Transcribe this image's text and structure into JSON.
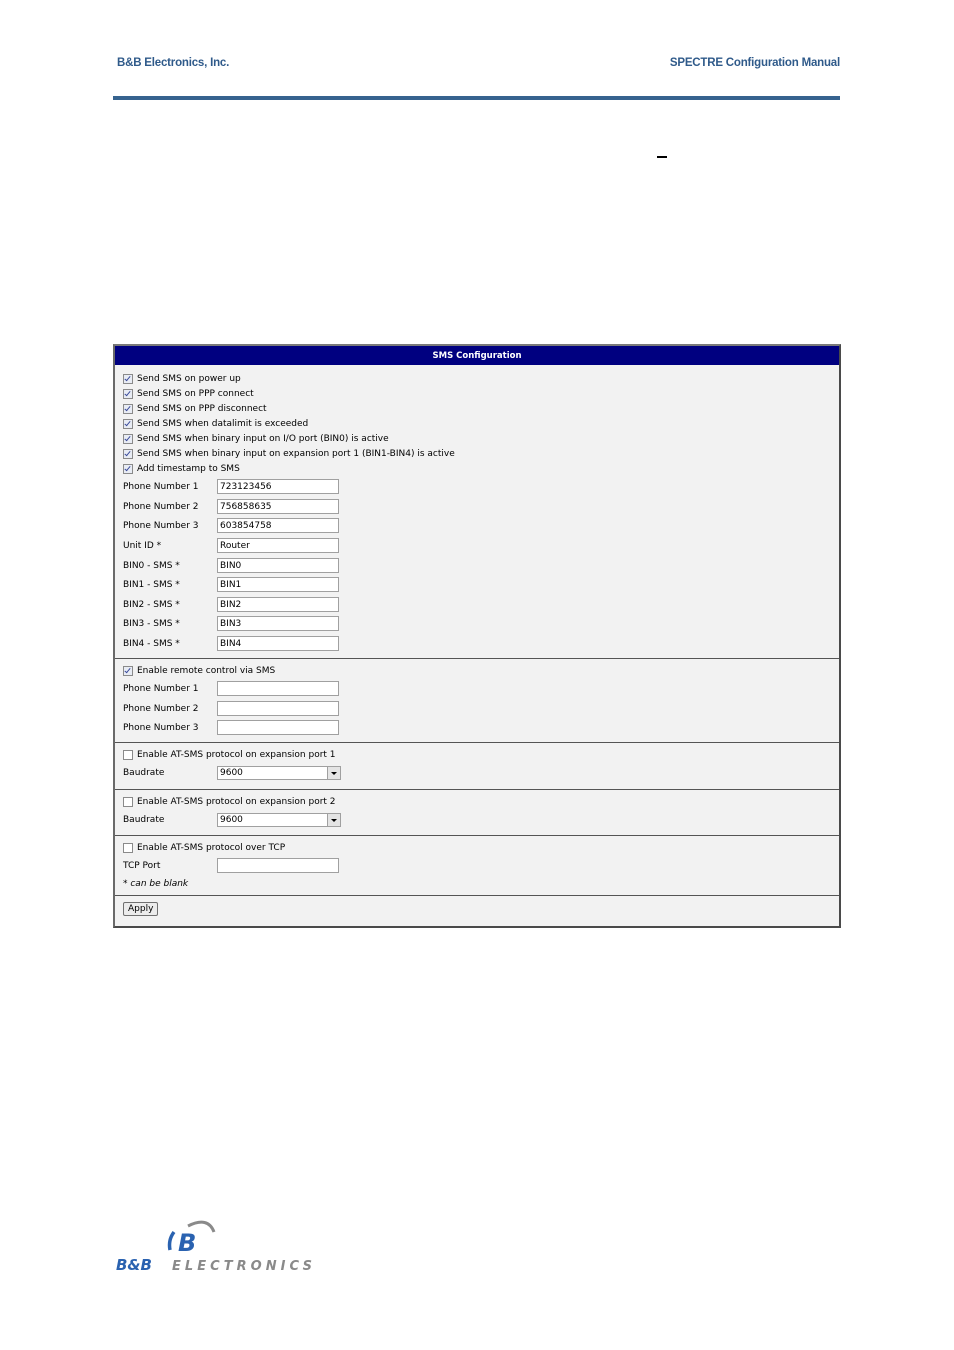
{
  "header": {
    "company": "B&B Electronics, Inc.",
    "manual_title": "SPECTRE Configuration Manual"
  },
  "panel": {
    "title": "SMS Configuration",
    "checkboxes": [
      {
        "label": "Send SMS on power up",
        "checked": true
      },
      {
        "label": "Send SMS on PPP connect",
        "checked": true
      },
      {
        "label": "Send SMS on PPP disconnect",
        "checked": true
      },
      {
        "label": "Send SMS when datalimit is exceeded",
        "checked": true
      },
      {
        "label": "Send SMS when binary input on I/O port (BIN0) is active",
        "checked": true
      },
      {
        "label": "Send SMS when binary input on expansion port 1 (BIN1-BIN4) is active",
        "checked": true
      },
      {
        "label": "Add timestamp to SMS",
        "checked": true
      }
    ],
    "fields": [
      {
        "label": "Phone Number 1",
        "value": "723123456"
      },
      {
        "label": "Phone Number 2",
        "value": "756858635"
      },
      {
        "label": "Phone Number 3",
        "value": "603854758"
      },
      {
        "label": "Unit ID *",
        "value": "Router"
      },
      {
        "label": "BIN0 - SMS *",
        "value": "BIN0"
      },
      {
        "label": "BIN1 - SMS *",
        "value": "BIN1"
      },
      {
        "label": "BIN2 - SMS *",
        "value": "BIN2"
      },
      {
        "label": "BIN3 - SMS *",
        "value": "BIN3"
      },
      {
        "label": "BIN4 - SMS *",
        "value": "BIN4"
      }
    ],
    "remote": {
      "checkbox_label": "Enable remote control via SMS",
      "checked": true,
      "fields": [
        {
          "label": "Phone Number 1",
          "value": ""
        },
        {
          "label": "Phone Number 2",
          "value": ""
        },
        {
          "label": "Phone Number 3",
          "value": ""
        }
      ]
    },
    "port1": {
      "checkbox_label": "Enable AT-SMS protocol on expansion port 1",
      "checked": false,
      "baud_label": "Baudrate",
      "baud_value": "9600"
    },
    "port2": {
      "checkbox_label": "Enable AT-SMS protocol on expansion port 2",
      "checked": false,
      "baud_label": "Baudrate",
      "baud_value": "9600"
    },
    "tcp": {
      "checkbox_label": "Enable AT-SMS protocol over TCP",
      "checked": false,
      "port_label": "TCP Port",
      "port_value": "",
      "note": "* can be blank"
    },
    "apply_label": "Apply"
  },
  "footer": {
    "logo_letter": "B",
    "logo_text_left": "B&B",
    "logo_text_right": "ELECTRONICS"
  }
}
